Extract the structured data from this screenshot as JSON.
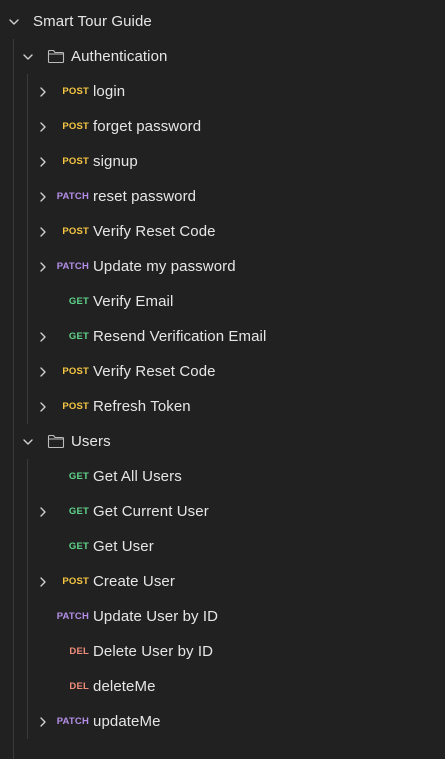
{
  "collection": {
    "name": "Smart Tour Guide",
    "expanded": true,
    "folders": [
      {
        "name": "Authentication",
        "expanded": true,
        "requests": [
          {
            "method": "POST",
            "name": "login",
            "has_children": true
          },
          {
            "method": "POST",
            "name": "forget password",
            "has_children": true
          },
          {
            "method": "POST",
            "name": "signup",
            "has_children": true
          },
          {
            "method": "PATCH",
            "name": "reset password",
            "has_children": true
          },
          {
            "method": "POST",
            "name": "Verify Reset Code",
            "has_children": true
          },
          {
            "method": "PATCH",
            "name": "Update my password",
            "has_children": true
          },
          {
            "method": "GET",
            "name": "Verify Email",
            "has_children": false
          },
          {
            "method": "GET",
            "name": "Resend Verification Email",
            "has_children": true
          },
          {
            "method": "POST",
            "name": "Verify Reset Code",
            "has_children": true
          },
          {
            "method": "POST",
            "name": "Refresh Token",
            "has_children": true
          }
        ]
      },
      {
        "name": "Users",
        "expanded": true,
        "requests": [
          {
            "method": "GET",
            "name": "Get All Users",
            "has_children": false
          },
          {
            "method": "GET",
            "name": "Get Current User",
            "has_children": true
          },
          {
            "method": "GET",
            "name": "Get User",
            "has_children": false
          },
          {
            "method": "POST",
            "name": "Create User",
            "has_children": true
          },
          {
            "method": "PATCH",
            "name": "Update User by ID",
            "has_children": false
          },
          {
            "method": "DEL",
            "name": "Delete User by ID",
            "has_children": false
          },
          {
            "method": "DEL",
            "name": "deleteMe",
            "has_children": false
          },
          {
            "method": "PATCH",
            "name": "updateMe",
            "has_children": true
          }
        ]
      }
    ]
  },
  "method_colors": {
    "POST": "#f5c542",
    "GET": "#5fd48a",
    "PATCH": "#b48ee8",
    "DEL": "#f08c7a"
  },
  "icons": {
    "expanded": "chevron-down-icon",
    "collapsed": "chevron-right-icon",
    "folder": "folder-icon"
  }
}
